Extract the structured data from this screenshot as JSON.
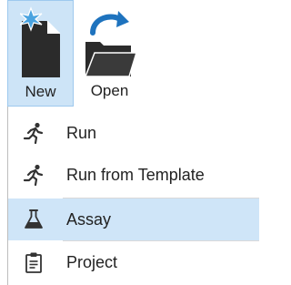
{
  "toolbar": {
    "new_label": "New",
    "open_label": "Open"
  },
  "menu": {
    "items": [
      {
        "label": "Run",
        "icon": "runner-icon"
      },
      {
        "label": "Run from Template",
        "icon": "runner-icon"
      },
      {
        "label": "Assay",
        "icon": "flask-icon",
        "highlighted": true
      },
      {
        "label": "Project",
        "icon": "clipboard-icon"
      }
    ]
  },
  "colors": {
    "highlight": "#cfe5f8",
    "new_button_bg": "#cde4f7",
    "icon_dark": "#2b2b2b",
    "accent_blue": "#1e73be"
  }
}
